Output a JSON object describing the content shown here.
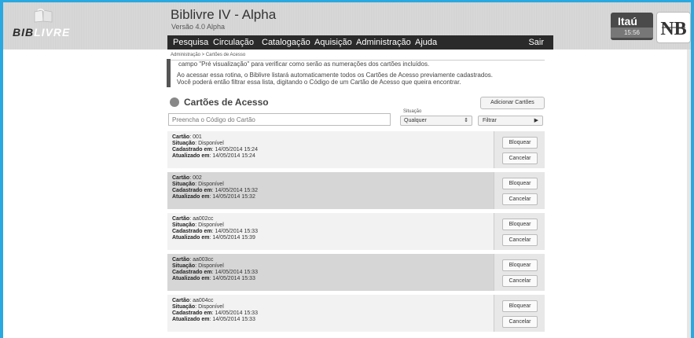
{
  "app": {
    "title": "Biblivre IV - Alpha",
    "version": "Versão 4.0 Alpha",
    "logo_text_dark": "BIB",
    "logo_text_light": "LIVRE"
  },
  "menu": {
    "items": [
      "Pesquisa",
      "Circulação",
      "Catalogação",
      "Aquisição",
      "Administração",
      "Ajuda"
    ],
    "logout": "Sair"
  },
  "client": {
    "name": "Itaú",
    "time": "15:56"
  },
  "breadcrumb": "Administração > Cartões de Acesso",
  "info": {
    "line1": "campo \"Pré visualização\" para verificar como serão as numerações dos cartões incluídos.",
    "line2": "Ao acessar essa rotina, o Biblivre listará automaticamente todos os Cartões de Acesso previamente cadastrados.",
    "line3": "Você poderá então filtrar essa lista, digitando o Código de um Cartão de Acesso que queira encontrar."
  },
  "section": {
    "title": "Cartões de Acesso",
    "add_button": "Adicionar Cartões"
  },
  "search": {
    "placeholder": "Preencha o Código do Cartão",
    "situation_label": "Situação",
    "situation_value": "Qualquer",
    "filter_button": "Filtrar"
  },
  "labels": {
    "card": "Cartão",
    "status": "Situação",
    "created": "Cadastrado em",
    "updated": "Atualizado em",
    "block": "Bloquear",
    "cancel": "Cancelar"
  },
  "cards": [
    {
      "code": ": 001",
      "status": ": Disponível",
      "created": ": 14/05/2014 15:24",
      "updated": ": 14/05/2014 15:24"
    },
    {
      "code": ": 002",
      "status": ": Disponível",
      "created": ": 14/05/2014 15:32",
      "updated": ": 14/05/2014 15:32"
    },
    {
      "code": ": aa002cc",
      "status": ": Disponível",
      "created": ": 14/05/2014 15:33",
      "updated": ": 14/05/2014 15:39"
    },
    {
      "code": ": aa003cc",
      "status": ": Disponível",
      "created": ": 14/05/2014 15:33",
      "updated": ": 14/05/2014 15:33"
    },
    {
      "code": ": aa004cc",
      "status": ": Disponível",
      "created": ": 14/05/2014 15:33",
      "updated": ": 14/05/2014 15:33"
    }
  ],
  "icons": {
    "logo": "book-icon",
    "section": "card-icon",
    "client_logo": "nb-monogram-icon"
  },
  "colors": {
    "frame": "#2aa8e0",
    "menubar": "#2a2a2a"
  }
}
